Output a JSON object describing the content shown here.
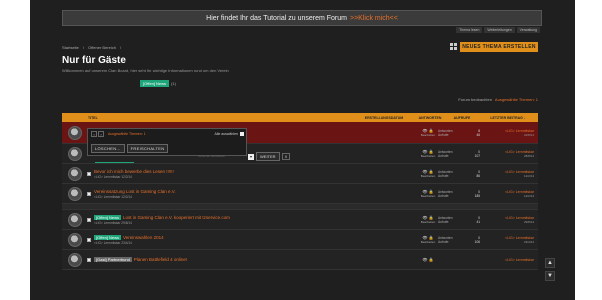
{
  "banner": {
    "text": "Hier findet Ihr das Tutorial zu unserem Forum",
    "link": ">>Klick mich<<"
  },
  "toplinks": [
    "Thema lesen",
    "Weiterleitungen",
    "Verwaltung"
  ],
  "breadcrumbs": [
    "Startseite",
    "Offener Bereich"
  ],
  "page": {
    "title": "Nur für Gäste",
    "description": "Willkommen auf unserem Clan Board, hier seht Ihr wichtige Informationen rund um den Verein",
    "new_thread": "NEUES THEMA ERSTELLEN"
  },
  "prefix_filter": {
    "label": "[Offen] News",
    "count": "(1)"
  },
  "watch": {
    "label": "Forum beobachten",
    "selected": "Ausgewählte Themen: 1"
  },
  "table": {
    "headers": {
      "title": "TITEL",
      "created": "ERSTELLUNGSDATUM",
      "views": "ANTWORTEN",
      "replies": "AUFRUFE",
      "last": "LETZTER BEITRAG ↓"
    },
    "rows": [
      {
        "prefix": "",
        "prefix2": "",
        "title": "",
        "meta": "<LIG> Lernmitskar 22/8/14",
        "replies": "8",
        "views": "46",
        "last_user": "<LIG> Lernmitskar",
        "last_date": "22/8/14",
        "action": "Bearbeiten"
      },
      {
        "prefix": "",
        "prefix2": "",
        "title": "",
        "meta": "<LIG> Lernmitskar 28/8/14",
        "replies": "0",
        "views": "107",
        "last_user": "<LIG> Lernmitskar",
        "last_date": "28/8/14",
        "action": "Bearbeiten"
      },
      {
        "prefix": "",
        "prefix2": "",
        "title": "Bevor ich mich bewerbe dies Lesen !!!!!!",
        "meta": "<LIG> Lernmitskar 12/2/14",
        "replies": "0",
        "views": "86",
        "last_user": "<LIG> Lernmitskar",
        "last_date": "12/2/14",
        "action": "Bearbeiten"
      },
      {
        "prefix": "",
        "prefix2": "",
        "title": "Vereinssatzung Lost in Gaming Clan e.V.",
        "meta": "<LIG> Lernmitskar 12/2/14",
        "replies": "0",
        "views": "185",
        "last_user": "<LIG> Lernmitskar",
        "last_date": "12/2/14",
        "action": "Bearbeiten"
      },
      {
        "prefix": "[Offen] News",
        "prefix2": "",
        "title": "Lost in Gaming Clan e.V. kooperiert mit tzservice.com",
        "meta": "<LIG> Lernmitskar 29/8/14",
        "replies": "0",
        "views": "41",
        "last_user": "<LIG> Lernmitskar",
        "last_date": "29/8/14",
        "action": "Bearbeiten"
      },
      {
        "prefix": "[Offen] News",
        "prefix2": "",
        "title": "Vereinswahlen 2014",
        "meta": "<LIG> Lernmitskar 23/4/14",
        "replies": "0",
        "views": "106",
        "last_user": "<LIG> Lernmitskar",
        "last_date": "23/4/14",
        "action": "Bearbeiten"
      },
      {
        "prefix": "",
        "prefix2": "[Gast] Partnerbund",
        "title": "Planen Battlefield 4 online!",
        "meta": "",
        "replies": "",
        "views": "",
        "last_user": "<LIG> Lernmitskar",
        "last_date": "",
        "action": ""
      }
    ],
    "stat_labels": {
      "replies": "Antworten:",
      "views": "Aufrufe:"
    }
  },
  "inline_mod": {
    "selected_title": "Ausgewählte Themen: 1",
    "select_all": "Alle auswählen",
    "btn_delete": "LÖSCHEN...",
    "btn_unlock": "FREISCHALTEN",
    "hint": "Optionen auswählen",
    "go": "WEITER",
    "close": "X",
    "progress": 0.3
  },
  "icons": [
    "eye-icon",
    "lock-icon",
    "chevron-up-icon",
    "chevron-down-icon",
    "grid-icon"
  ]
}
